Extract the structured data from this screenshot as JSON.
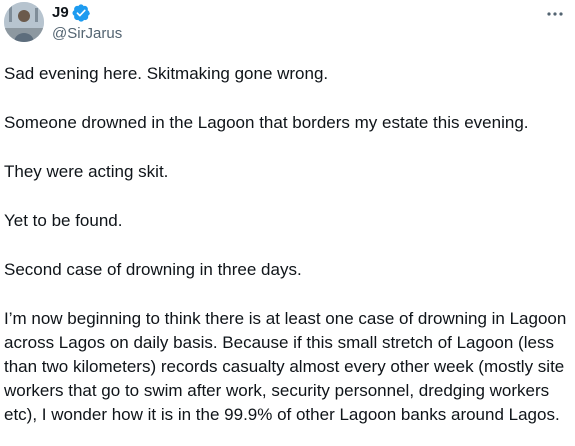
{
  "author": {
    "display_name": "J9",
    "handle": "@SirJarus",
    "verified": true
  },
  "icons": {
    "avatar": "profile-photo",
    "verified": "verified-badge-icon",
    "more": "more-options-icon"
  },
  "colors": {
    "text": "#0f1419",
    "secondary": "#536471",
    "verified_blue": "#1d9bf0"
  },
  "tweet": {
    "paragraphs": [
      "Sad evening here. Skitmaking gone wrong.",
      "Someone drowned in the Lagoon that borders my estate this evening.",
      "They were acting skit.",
      "Yet to be found.",
      "Second case of drowning in three days.",
      "I’m now beginning to think there is at least one case of drowning in Lagoon across Lagos on daily basis. Because if this small stretch of Lagoon (less than two kilometers) records casualty almost every other week (mostly site workers that go to swim after work, security personnel, dredging workers etc), I wonder how it is in the 99.9% of other Lagoon banks around Lagos."
    ]
  }
}
